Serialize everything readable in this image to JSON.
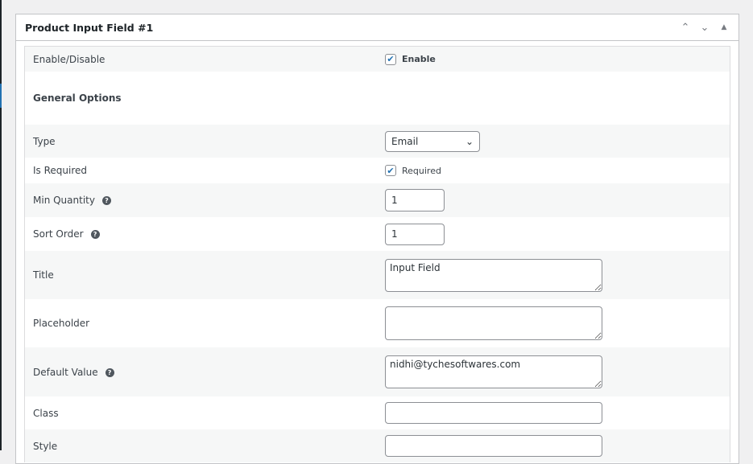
{
  "panel": {
    "title": "Product Input Field #1"
  },
  "rows": {
    "enable": {
      "label": "Enable/Disable",
      "checkbox": "Enable"
    },
    "general": {
      "label": "General Options"
    },
    "type": {
      "label": "Type",
      "value": "Email"
    },
    "required": {
      "label": "Is Required",
      "checkbox": "Required"
    },
    "min_qty": {
      "label": "Min Quantity",
      "value": "1"
    },
    "sort_order": {
      "label": "Sort Order",
      "value": "1"
    },
    "title": {
      "label": "Title",
      "value": "Input Field"
    },
    "placeholder": {
      "label": "Placeholder",
      "value": ""
    },
    "default_value": {
      "label": "Default Value",
      "value": "nidhi@tychesoftwares.com"
    },
    "class": {
      "label": "Class",
      "value": ""
    },
    "style": {
      "label": "Style",
      "value": ""
    }
  }
}
